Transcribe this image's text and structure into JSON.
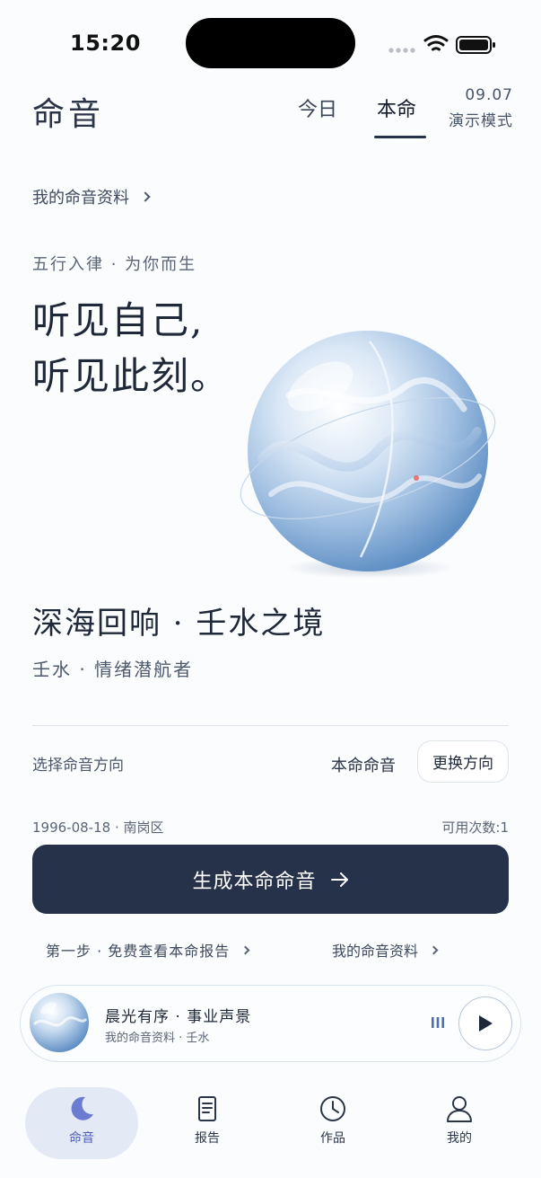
{
  "status_bar": {
    "time": "15:20"
  },
  "header": {
    "app_title": "命音",
    "tabs": [
      {
        "label": "今日",
        "active": false
      },
      {
        "label": "本命",
        "active": true
      }
    ],
    "date": "09.07",
    "mode": "演示模式"
  },
  "profile_link": "我的命音资料",
  "tagline": "五行入律 · 为你而生",
  "hero": {
    "line1": "听见自己,",
    "line2": "听见此刻。"
  },
  "sound": {
    "title": "深海回响 · 壬水之境",
    "subtitle": "壬水 · 情绪潜航者"
  },
  "direction": {
    "label": "选择命音方向",
    "value": "本命命音",
    "button": "更换方向"
  },
  "birth_info": "1996-08-18 · 南岗区",
  "uses_left": "可用次数:1",
  "generate_button": "生成本命命音",
  "links": {
    "step": "第一步 · 免费查看本命报告",
    "profile": "我的命音资料"
  },
  "player": {
    "title": "晨光有序 · 事业声景",
    "subtitle": "我的命音资料 · 壬水"
  },
  "nav": [
    {
      "label": "命音",
      "icon": "moon-icon",
      "active": true
    },
    {
      "label": "报告",
      "icon": "document-icon",
      "active": false
    },
    {
      "label": "作品",
      "icon": "clock-icon",
      "active": false
    },
    {
      "label": "我的",
      "icon": "person-icon",
      "active": false
    }
  ],
  "colors": {
    "accent_dark": "#26324a",
    "nav_active": "#4f5fb8",
    "nav_active_bg": "#e3e9f5"
  }
}
